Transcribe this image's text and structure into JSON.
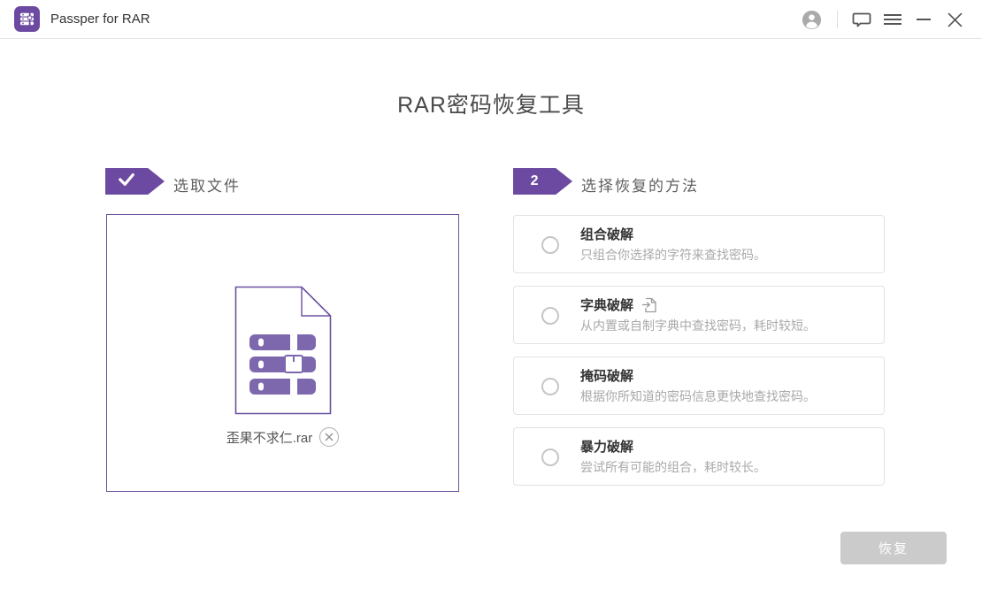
{
  "titlebar": {
    "app_title": "Passper for RAR"
  },
  "page": {
    "title": "RAR密码恢复工具"
  },
  "steps": {
    "step1": {
      "label": "选取文件",
      "badge": "check"
    },
    "step2": {
      "label": "选择恢复的方法",
      "number": "2"
    }
  },
  "file": {
    "name": "歪果不求仁.rar"
  },
  "methods": [
    {
      "title": "组合破解",
      "description": "只组合你选择的字符来查找密码。",
      "selected": false
    },
    {
      "title": "字典破解",
      "description": "从内置或自制字典中查找密码，耗时较短。",
      "selected": false,
      "icon": "import-dictionary-icon"
    },
    {
      "title": "掩码破解",
      "description": "根据你所知道的密码信息更快地查找密码。",
      "selected": false
    },
    {
      "title": "暴力破解",
      "description": "尝试所有可能的组合，耗时较长。",
      "selected": false
    }
  ],
  "footer": {
    "recover_label": "恢复",
    "recover_enabled": false
  },
  "colors": {
    "accent_purple": "#6d4aa1",
    "archive_purple": "#7d68ae",
    "file_box_border": "#6b519f",
    "card_border": "#e2e2e2",
    "disabled_button": "#cbcbcb",
    "description_gray": "#a9a9a9"
  }
}
